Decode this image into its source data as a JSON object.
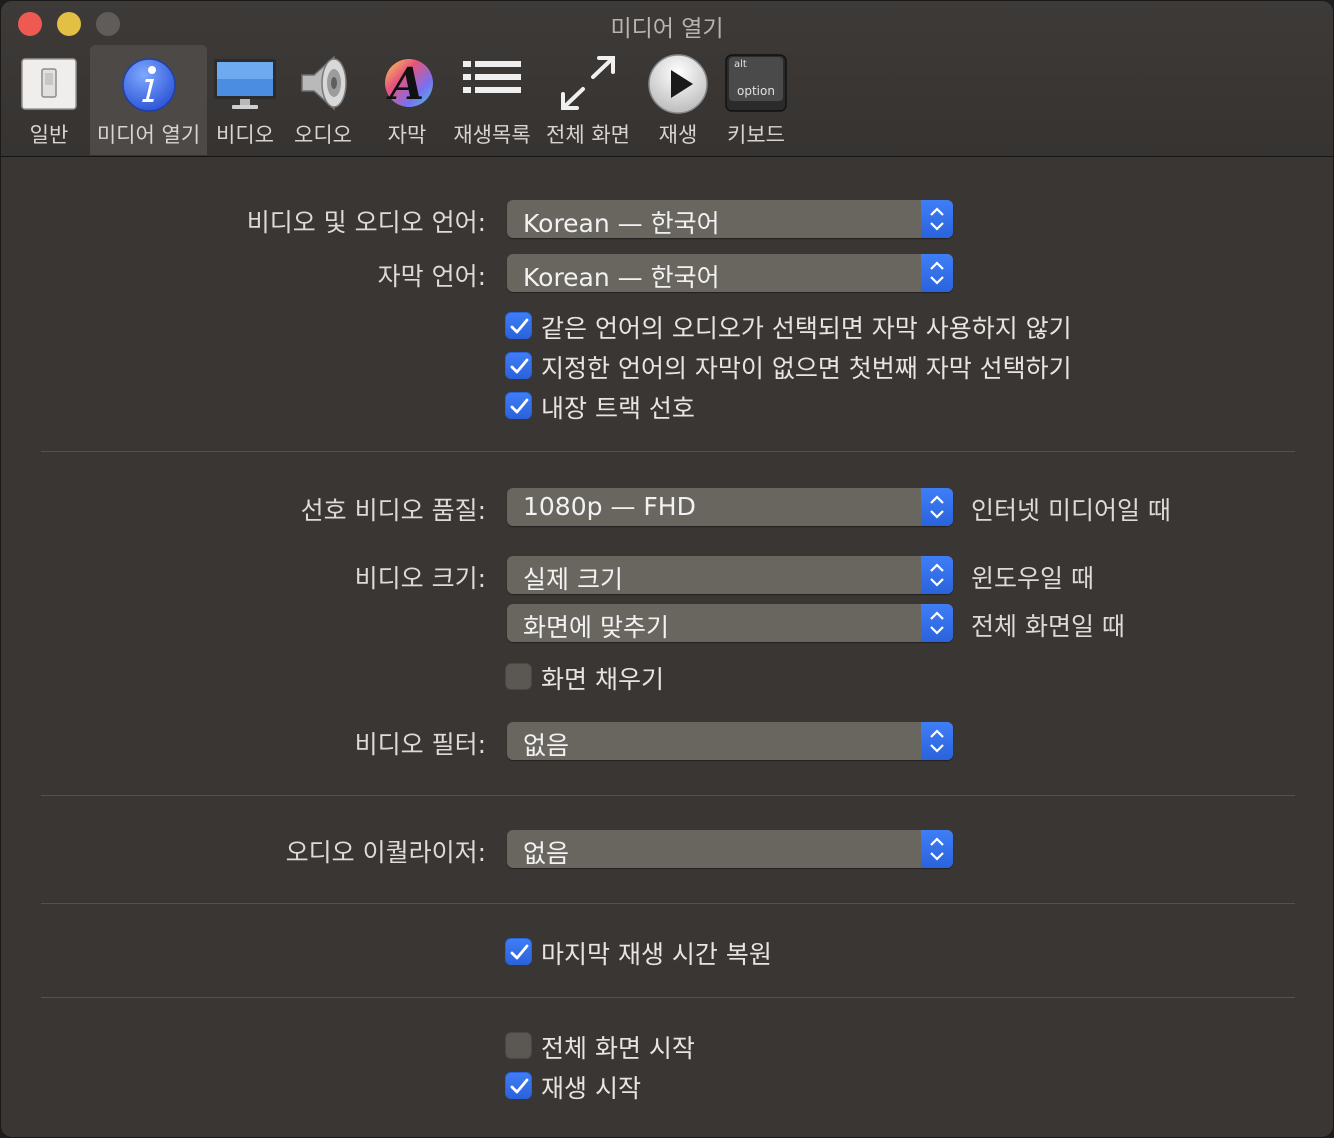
{
  "window": {
    "title": "미디어 열기"
  },
  "toolbar": {
    "tabs": [
      {
        "label": "일반",
        "icon": "switch-icon"
      },
      {
        "label": "미디어 열기",
        "icon": "info-icon"
      },
      {
        "label": "비디오",
        "icon": "monitor-icon"
      },
      {
        "label": "오디오",
        "icon": "speaker-icon"
      },
      {
        "label": "자막",
        "icon": "font-icon"
      },
      {
        "label": "재생목록",
        "icon": "list-icon"
      },
      {
        "label": "전체 화면",
        "icon": "fullscreen-icon"
      },
      {
        "label": "재생",
        "icon": "play-icon"
      },
      {
        "label": "키보드",
        "icon": "keyboard-icon",
        "key_top": "alt",
        "key_bottom": "option"
      }
    ],
    "selected": "미디어 열기"
  },
  "language": {
    "av_label": "비디오 및 오디오 언어:",
    "av_value": "Korean — 한국어",
    "sub_label": "자막 언어:",
    "sub_value": "Korean — 한국어",
    "checks": [
      {
        "label": "같은 언어의 오디오가 선택되면 자막 사용하지 않기",
        "checked": true
      },
      {
        "label": "지정한 언어의 자막이 없으면 첫번째 자막 선택하기",
        "checked": true
      },
      {
        "label": "내장 트랙 선호",
        "checked": true
      }
    ]
  },
  "video": {
    "quality_label": "선호 비디오 품질:",
    "quality_value": "1080p — FHD",
    "quality_note": "인터넷 미디어일 때",
    "size_label": "비디오 크기:",
    "size_window_value": "실제 크기",
    "size_window_note": "윈도우일 때",
    "size_full_value": "화면에 맞추기",
    "size_full_note": "전체 화면일 때",
    "fill_label": "화면 채우기",
    "fill_checked": false,
    "filter_label": "비디오 필터:",
    "filter_value": "없음"
  },
  "audio": {
    "eq_label": "오디오 이퀄라이저:",
    "eq_value": "없음"
  },
  "resume": {
    "label": "마지막 재생 시간 복원",
    "checked": true
  },
  "start": {
    "fullscreen_label": "전체 화면 시작",
    "fullscreen_checked": false,
    "play_label": "재생 시작",
    "play_checked": true
  },
  "colors": {
    "accent": "#2f6fe8",
    "close": "#ee5a52",
    "minimize": "#e2c044"
  }
}
